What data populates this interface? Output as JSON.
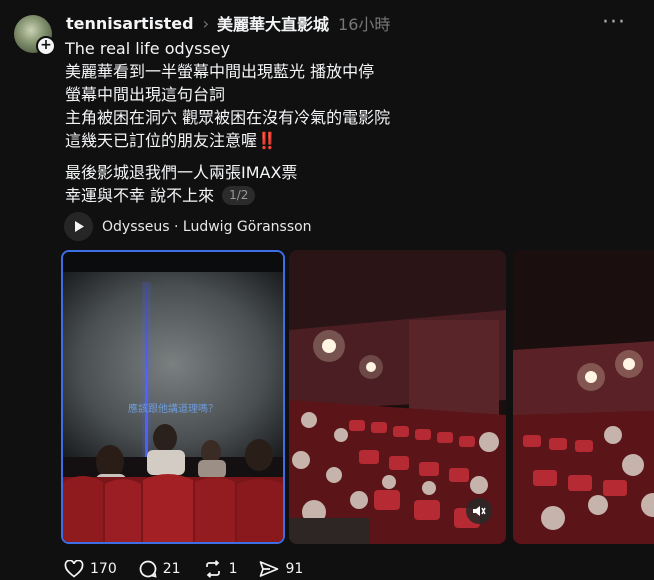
{
  "post": {
    "username": "tennisartisted",
    "community": "美麗華大直影城",
    "time": "16小時",
    "lines": [
      "The real life odyssey",
      "美麗華看到一半螢幕中間出現藍光 播放中停",
      "螢幕中間出現這句台詞",
      "主角被困在洞穴 觀眾被困在沒有冷氣的電影院",
      "這幾天已訂位的朋友注意喔‼️"
    ],
    "lines2": [
      "最後影城退我們一人兩張IMAX票",
      "幸運與不幸 說不上來"
    ],
    "page_indicator": "1/2",
    "music": "Odysseus · Ludwig Göransson",
    "screen_caption": "應該跟他講道理嗎？",
    "likes": "170",
    "comments": "21",
    "reposts": "1",
    "shares": "91"
  },
  "colors": {
    "accent_border": "#3d6ee6",
    "background": "#101010"
  }
}
